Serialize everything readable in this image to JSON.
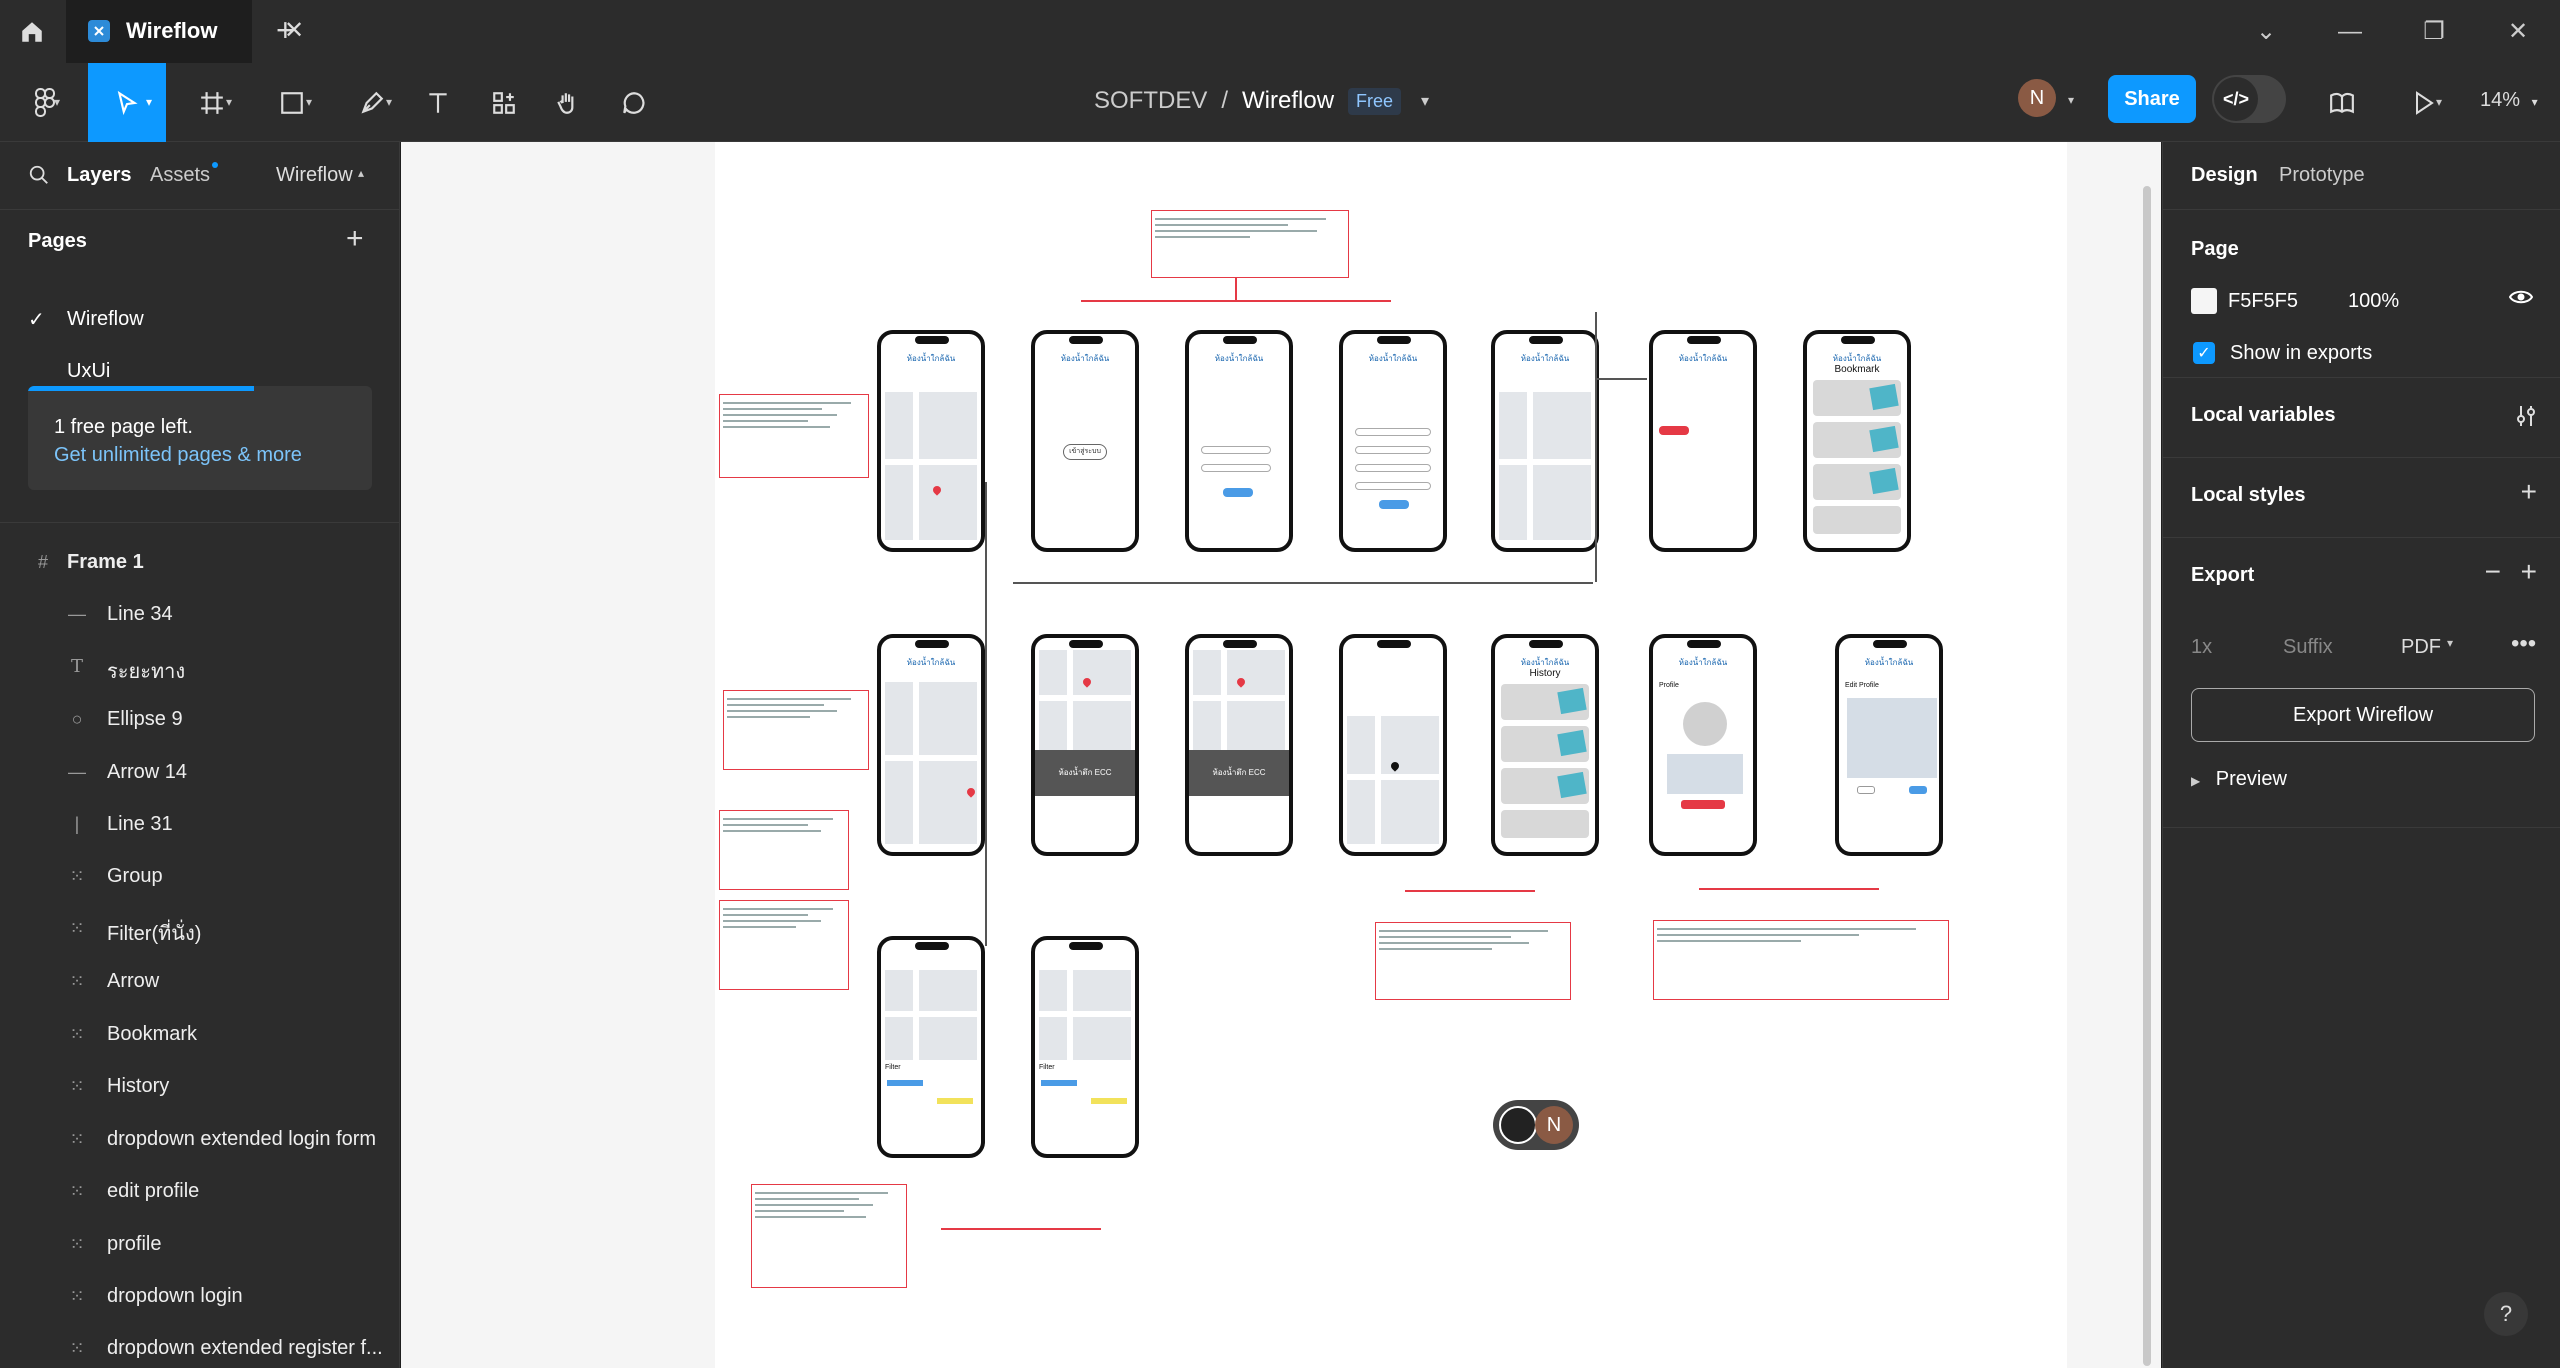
{
  "tabbar": {
    "tab_title": "Wireflow",
    "close_glyph": "✕",
    "new_tab_glyph": "+",
    "window_controls": [
      "⌄",
      "—",
      "❐",
      "✕"
    ]
  },
  "toolbar": {
    "project": "SOFTDEV",
    "separator": "/",
    "file": "Wireflow",
    "plan_badge": "Free",
    "avatar_initial": "N",
    "share_label": "Share",
    "zoom": "14%",
    "active_tool": "move-tool"
  },
  "left_panel": {
    "tabs": {
      "layers": "Layers",
      "assets": "Assets",
      "page_switch": "Wireflow"
    },
    "pages_header": "Pages",
    "pages": [
      {
        "label": "Wireflow",
        "current": true
      },
      {
        "label": "UxUi",
        "current": false
      }
    ],
    "upsell": {
      "line1": "1 free page left.",
      "line2": "Get unlimited pages & more"
    },
    "frame": "Frame 1",
    "layers": [
      {
        "name": "Line 34",
        "icon": "line-icon"
      },
      {
        "name": "ระยะทาง",
        "icon": "text-icon"
      },
      {
        "name": "Ellipse 9",
        "icon": "ellipse-icon"
      },
      {
        "name": "Arrow 14",
        "icon": "line-icon"
      },
      {
        "name": "Line 31",
        "icon": "vline-icon"
      },
      {
        "name": "Group",
        "icon": "group-icon"
      },
      {
        "name": "Filter(ที่นั่ง)",
        "icon": "group-icon"
      },
      {
        "name": "Arrow",
        "icon": "group-icon"
      },
      {
        "name": "Bookmark",
        "icon": "group-icon"
      },
      {
        "name": "History",
        "icon": "group-icon"
      },
      {
        "name": "dropdown extended login form",
        "icon": "group-icon"
      },
      {
        "name": "edit profile",
        "icon": "group-icon"
      },
      {
        "name": "profile",
        "icon": "group-icon"
      },
      {
        "name": "dropdown login",
        "icon": "group-icon"
      },
      {
        "name": "dropdown extended register f...",
        "icon": "group-icon"
      }
    ]
  },
  "canvas": {
    "phone_title": "ห้องน้ำใกล้ฉัน",
    "bookmark_title": "Bookmark",
    "history_title": "History",
    "profile_title": "Profile",
    "edit_profile_title": "Edit Profile",
    "filter_title": "Filter",
    "ecc_label": "ห้องน้ำตึก ECC",
    "find_button": "เข้าสู่ระบบ",
    "collaborator_initial": "N"
  },
  "right_panel": {
    "tabs": {
      "design": "Design",
      "prototype": "Prototype"
    },
    "page_header": "Page",
    "page_color": "F5F5F5",
    "page_opacity": "100%",
    "show_in_exports": "Show in exports",
    "local_variables": "Local variables",
    "local_styles": "Local styles",
    "export_header": "Export",
    "export_scale": "1x",
    "export_suffix": "Suffix",
    "export_format": "PDF",
    "export_button": "Export Wireflow",
    "preview": "Preview",
    "help": "?"
  },
  "colors": {
    "accent": "#0d99ff",
    "annotation_red": "#e53945",
    "canvas_bg": "#f5f5f5",
    "panel_bg": "#2c2c2c"
  }
}
